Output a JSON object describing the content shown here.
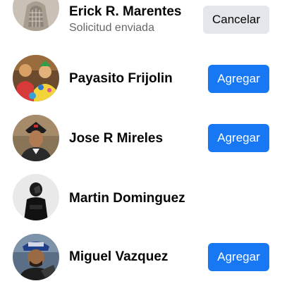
{
  "requests": [
    {
      "name": "Erick R. Marentes",
      "status": "Solicitud enviada",
      "action_label": "Cancelar",
      "avatar": "profile-photo"
    },
    {
      "name": "Payasito Frijolin",
      "action_label": "Agregar",
      "avatar": "profile-photo"
    },
    {
      "name": "Jose R Mireles",
      "action_label": "Agregar",
      "avatar": "profile-photo"
    },
    {
      "name": "Martin Dominguez",
      "avatar": "profile-photo"
    },
    {
      "name": "Miguel Vazquez",
      "action_label": "Agregar",
      "avatar": "profile-photo"
    }
  ],
  "colors": {
    "primary_button": "#1877f2",
    "secondary_button": "#e4e6eb",
    "secondary_text": "#65676b"
  }
}
